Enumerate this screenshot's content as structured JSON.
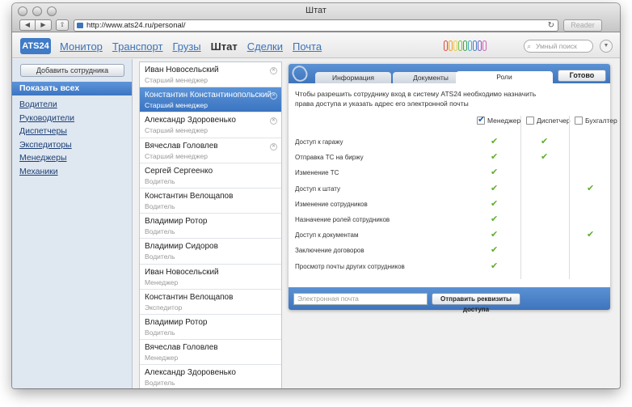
{
  "window": {
    "title": "Штат"
  },
  "browser": {
    "url": "http://www.ats24.ru/personal/",
    "reader_label": "Reader"
  },
  "header": {
    "logo": "ATS24",
    "nav": [
      {
        "label": "Монитор",
        "active": false
      },
      {
        "label": "Транспорт",
        "active": false
      },
      {
        "label": "Грузы",
        "active": false
      },
      {
        "label": "Штат",
        "active": true
      },
      {
        "label": "Сделки",
        "active": false
      },
      {
        "label": "Почта",
        "active": false
      }
    ],
    "clip_colors": [
      "#e0463a",
      "#f0a020",
      "#f4d02e",
      "#7cc043",
      "#3ea34a",
      "#40b0c8",
      "#3f7bc6",
      "#7b58c4",
      "#d061b5"
    ],
    "search_placeholder": "Умный поиск"
  },
  "sidebar": {
    "add_label": "Добавить сотрудника",
    "show_all": "Показать всех",
    "roles": [
      "Водители",
      "Руководители",
      "Диспетчеры",
      "Экспедиторы",
      "Менеджеры",
      "Механики"
    ]
  },
  "employees": [
    {
      "name": "Иван Новосельский",
      "role": "Старший менеджер",
      "selected": false,
      "removable": true
    },
    {
      "name": "Константин Константинопольский",
      "role": "Старший менеджер",
      "selected": true,
      "removable": true
    },
    {
      "name": "Александр Здоровенько",
      "role": "Старший менеджер",
      "selected": false,
      "removable": true
    },
    {
      "name": "Вячеслав Головлев",
      "role": "Старший менеджер",
      "selected": false,
      "removable": true
    },
    {
      "name": "Сергей Сергеенко",
      "role": "Водитель",
      "selected": false,
      "removable": false
    },
    {
      "name": "Константин Велощапов",
      "role": "Водитель",
      "selected": false,
      "removable": false
    },
    {
      "name": "Владимир Ротор",
      "role": "Водитель",
      "selected": false,
      "removable": false
    },
    {
      "name": "Владимир Сидоров",
      "role": "Водитель",
      "selected": false,
      "removable": false
    },
    {
      "name": "Иван Новосельский",
      "role": "Менеджер",
      "selected": false,
      "removable": false
    },
    {
      "name": "Константин Велощапов",
      "role": "Экспедитор",
      "selected": false,
      "removable": false
    },
    {
      "name": "Владимир Ротор",
      "role": "Водитель",
      "selected": false,
      "removable": false
    },
    {
      "name": "Вячеслав Головлев",
      "role": "Менеджер",
      "selected": false,
      "removable": false
    },
    {
      "name": "Александр Здоровенько",
      "role": "Водитель",
      "selected": false,
      "removable": false
    }
  ],
  "card": {
    "tabs": [
      {
        "label": "Информация",
        "active": false
      },
      {
        "label": "Документы",
        "active": false
      },
      {
        "label": "Роли",
        "active": true
      }
    ],
    "done_label": "Готово",
    "intro": "Чтобы разрешить сотруднику вход в систему ATS24 необходимо назначить права доступа и указать адрес его электронной почты",
    "columns": [
      {
        "label": "Менеджер",
        "checked": true
      },
      {
        "label": "Диспетчер",
        "checked": false
      },
      {
        "label": "Бухгалтер",
        "checked": false
      }
    ],
    "permissions": [
      {
        "label": "Доступ к гаражу",
        "grants": [
          true,
          true,
          false
        ]
      },
      {
        "label": "Отправка ТС на биржу",
        "grants": [
          true,
          true,
          false
        ]
      },
      {
        "label": "Изменение ТС",
        "grants": [
          true,
          false,
          false
        ]
      },
      {
        "label": "Доступ к штату",
        "grants": [
          true,
          false,
          true
        ]
      },
      {
        "label": "Изменение сотрудников",
        "grants": [
          true,
          false,
          false
        ]
      },
      {
        "label": "Назначение ролей сотрудников",
        "grants": [
          true,
          false,
          false
        ]
      },
      {
        "label": "Доступ к документам",
        "grants": [
          true,
          false,
          true
        ]
      },
      {
        "label": "Заключение договоров",
        "grants": [
          true,
          false,
          false
        ]
      },
      {
        "label": "Просмотр почты других сотрудников",
        "grants": [
          true,
          false,
          false
        ]
      }
    ],
    "email_placeholder": "Электронная почта",
    "send_label": "Отправить реквизиты доступа"
  },
  "colors": {
    "accent": "#3f7bc6",
    "check": "#5fae2d",
    "link": "#3d73b9"
  }
}
